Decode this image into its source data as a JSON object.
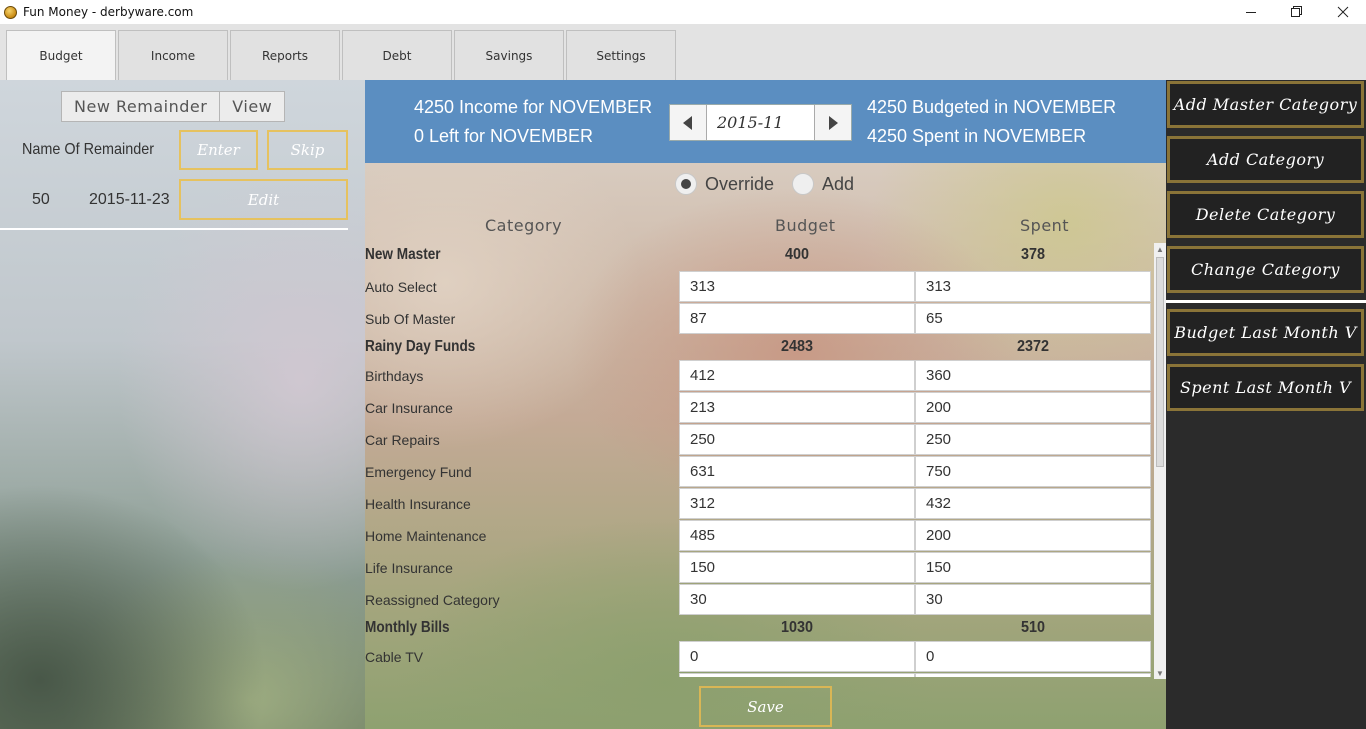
{
  "window": {
    "title": "Fun Money - derbyware.com"
  },
  "tabs": [
    {
      "label": "Budget",
      "active": true
    },
    {
      "label": "Income"
    },
    {
      "label": "Reports"
    },
    {
      "label": "Debt"
    },
    {
      "label": "Savings"
    },
    {
      "label": "Settings"
    }
  ],
  "remainders": {
    "new_label": "New Remainder",
    "view_label": "View",
    "item": {
      "name": "Name Of Remainder",
      "amount": "50",
      "date": "2015-11-23",
      "enter_label": "Enter",
      "skip_label": "Skip",
      "edit_label": "Edit"
    }
  },
  "header": {
    "income_text": "4250 Income for NOVEMBER",
    "left_text": "0 Left for NOVEMBER",
    "budgeted_text": "4250 Budgeted in NOVEMBER",
    "spent_text": "4250 Spent in NOVEMBER",
    "month_value": "2015-11"
  },
  "mode": {
    "override_label": "Override",
    "add_label": "Add",
    "selected": "Override"
  },
  "columns": {
    "category": "Category",
    "budget": "Budget",
    "spent": "Spent"
  },
  "groups": [
    {
      "name": "New Master",
      "budget": "400",
      "spent": "378",
      "items": [
        {
          "name": "Auto Select",
          "budget": "313",
          "spent": "313"
        },
        {
          "name": "Sub Of Master",
          "budget": "87",
          "spent": "65"
        }
      ]
    },
    {
      "name": "Rainy Day Funds",
      "budget": "2483",
      "spent": "2372",
      "items": [
        {
          "name": "Birthdays",
          "budget": "412",
          "spent": "360"
        },
        {
          "name": "Car Insurance",
          "budget": "213",
          "spent": "200"
        },
        {
          "name": "Car Repairs",
          "budget": "250",
          "spent": "250"
        },
        {
          "name": "Emergency Fund",
          "budget": "631",
          "spent": "750"
        },
        {
          "name": "Health Insurance",
          "budget": "312",
          "spent": "432"
        },
        {
          "name": "Home Maintenance",
          "budget": "485",
          "spent": "200"
        },
        {
          "name": "Life Insurance",
          "budget": "150",
          "spent": "150"
        },
        {
          "name": "Reassigned Category",
          "budget": "30",
          "spent": "30"
        }
      ]
    },
    {
      "name": "Monthly Bills",
      "budget": "1030",
      "spent": "510",
      "items": [
        {
          "name": "Cable TV",
          "budget": "0",
          "spent": "0"
        }
      ]
    }
  ],
  "save_label": "Save",
  "side_actions": [
    "Add Master Category",
    "Add Category",
    "Delete Category",
    "Change Category",
    "Budget Last Month V",
    "Spent Last Month V"
  ]
}
